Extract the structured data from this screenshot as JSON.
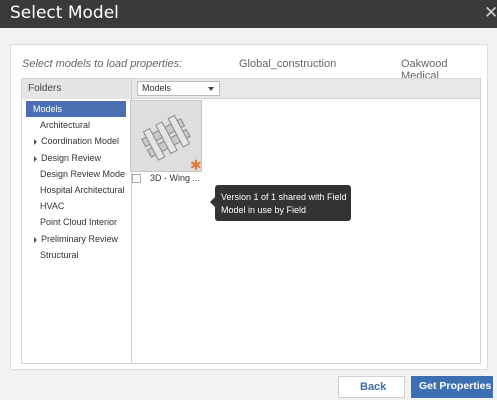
{
  "window": {
    "title": "Select Model",
    "close_glyph": "✕"
  },
  "header": {
    "instruction": "Select models to load properties:",
    "project": "Global_construction",
    "company": "Oakwood Medical"
  },
  "folders": {
    "label": "Folders",
    "items": [
      {
        "label": "Models",
        "selected": true,
        "expandable": false
      },
      {
        "label": "Architectural",
        "selected": false,
        "expandable": false
      },
      {
        "label": "Coordination Model",
        "selected": false,
        "expandable": true
      },
      {
        "label": "Design Review",
        "selected": false,
        "expandable": true
      },
      {
        "label": "Design Review Mode",
        "selected": false,
        "expandable": false
      },
      {
        "label": "Hospital Architectural",
        "selected": false,
        "expandable": false
      },
      {
        "label": "HVAC",
        "selected": false,
        "expandable": false
      },
      {
        "label": "Point Cloud Interior",
        "selected": false,
        "expandable": false
      },
      {
        "label": "Preliminary Review",
        "selected": false,
        "expandable": true
      },
      {
        "label": "Structural",
        "selected": false,
        "expandable": false
      }
    ]
  },
  "view_select": {
    "value": "Models"
  },
  "model_card": {
    "name": "3D - Wing ...",
    "badge": "✱",
    "tooltip_line1": "Version 1 of 1 shared with Field",
    "tooltip_line2": "Model in use by Field"
  },
  "buttons": {
    "back": "Back",
    "get_properties": "Get Properties"
  },
  "colors": {
    "accent": "#3d6fb2",
    "selected": "#4a6fb3",
    "badge": "#e07a3b",
    "titlebar": "#3a3a3a"
  }
}
